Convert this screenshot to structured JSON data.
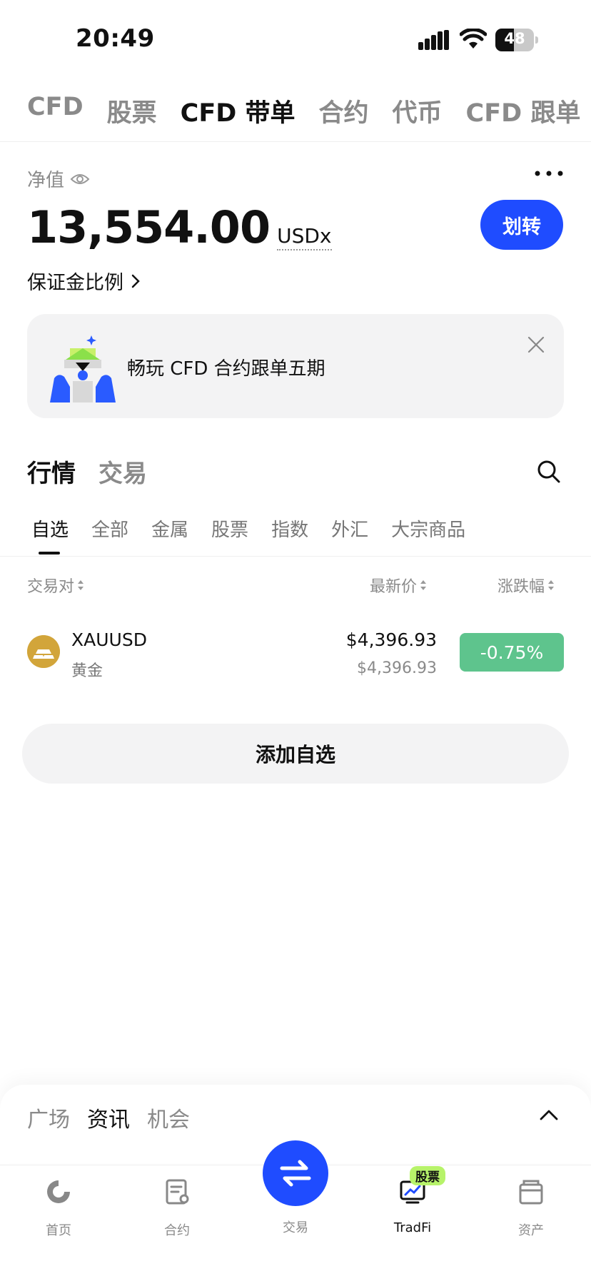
{
  "status_bar": {
    "time": "20:49",
    "battery": "48"
  },
  "top_tabs": [
    "CFD",
    "股票",
    "CFD 带单",
    "合约",
    "代币",
    "CFD 跟单"
  ],
  "top_tab_active": 2,
  "account": {
    "equity_label": "净值",
    "equity_value": "13,554.00",
    "equity_unit": "USDx",
    "transfer_label": "划转",
    "margin_ratio_label": "保证金比例"
  },
  "banner": {
    "text": "畅玩 CFD 合约跟单五期"
  },
  "section_tabs": [
    "行情",
    "交易"
  ],
  "category_tabs": [
    "自选",
    "全部",
    "金属",
    "股票",
    "指数",
    "外汇",
    "大宗商品"
  ],
  "columns": {
    "pair": "交易对",
    "last_price": "最新价",
    "change": "涨跌幅"
  },
  "rows": [
    {
      "symbol": "XAUUSD",
      "name": "黄金",
      "price": "$4,396.93",
      "mark_price": "$4,396.93",
      "change": "-0.75%"
    }
  ],
  "add_watchlist_label": "添加自选",
  "sheet_tabs": [
    "广场",
    "资讯",
    "机会"
  ],
  "nav": {
    "home": "首页",
    "futures": "合约",
    "trade": "交易",
    "tradfi": "TradFi",
    "tradfi_badge": "股票",
    "assets": "资产"
  },
  "colors": {
    "accent": "#1f4cff",
    "positive_badge": "#5ec48d",
    "gold": "#d2a53a",
    "badge_green": "#b7f36a"
  }
}
